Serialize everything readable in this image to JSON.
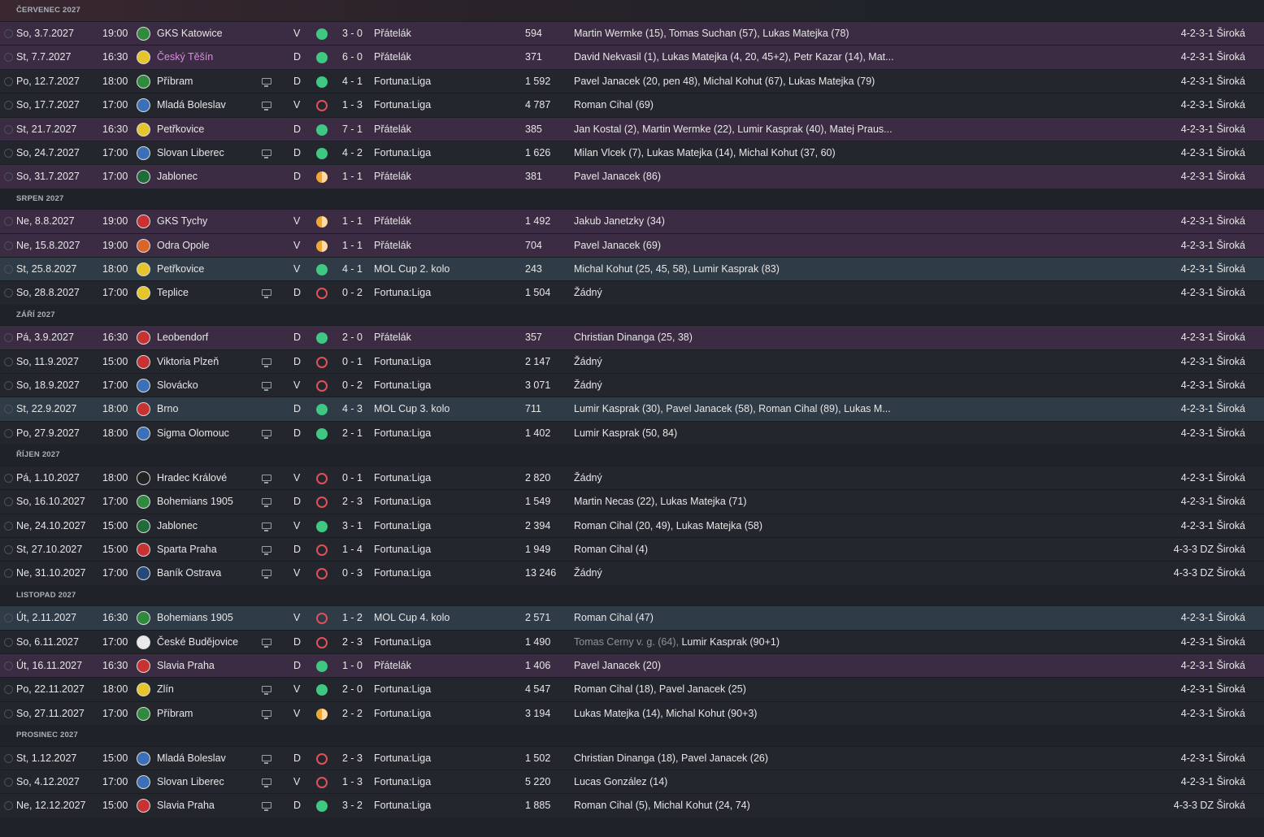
{
  "months": [
    {
      "label": "ČERVENEC 2027",
      "rows": [
        {
          "type": "friendly",
          "date": "So, 3.7.2027",
          "time": "19:00",
          "badge": "gks-katowice-crest-icon",
          "badge_color": "b-green",
          "team": "GKS Katowice",
          "tv": false,
          "venue": "V",
          "result": "w",
          "score": "3 - 0",
          "comp": "Přátelák",
          "att": "594",
          "scorers": "Martin Wermke (15), Tomas Suchan (57), Lukas Matejka (78)",
          "form": "4-2-3-1 Široká"
        },
        {
          "type": "friendly",
          "date": "St, 7.7.2027",
          "time": "16:30",
          "badge": "cesky-tesin-crest-icon",
          "badge_color": "b-yellow",
          "team": "Český Těšín",
          "team_hl": true,
          "tv": false,
          "venue": "D",
          "result": "w",
          "score": "6 - 0",
          "comp": "Přátelák",
          "att": "371",
          "scorers": "David Nekvasil (1), Lukas Matejka (4, 20, 45+2), Petr Kazar (14), Mat...",
          "form": "4-2-3-1 Široká"
        },
        {
          "type": "league",
          "date": "Po, 12.7.2027",
          "time": "18:00",
          "badge": "pribram-crest-icon",
          "badge_color": "b-green",
          "team": "Příbram",
          "tv": true,
          "venue": "D",
          "result": "w",
          "score": "4 - 1",
          "comp": "Fortuna:Liga",
          "att": "1 592",
          "scorers": "Pavel Janacek (20, pen 48), Michal Kohut (67), Lukas Matejka (79)",
          "form": "4-2-3-1 Široká"
        },
        {
          "type": "league",
          "date": "So, 17.7.2027",
          "time": "17:00",
          "badge": "mlada-boleslav-crest-icon",
          "badge_color": "b-blue",
          "team": "Mladá Boleslav",
          "tv": true,
          "venue": "V",
          "result": "l",
          "score": "1 - 3",
          "comp": "Fortuna:Liga",
          "att": "4 787",
          "scorers": "Roman Cihal (69)",
          "form": "4-2-3-1 Široká"
        },
        {
          "type": "friendly",
          "date": "St, 21.7.2027",
          "time": "16:30",
          "badge": "petrkovice-crest-icon",
          "badge_color": "b-yellow",
          "team": "Petřkovice",
          "tv": false,
          "venue": "D",
          "result": "w",
          "score": "7 - 1",
          "comp": "Přátelák",
          "att": "385",
          "scorers": "Jan Kostal (2), Martin Wermke (22), Lumir Kasprak (40), Matej Praus...",
          "form": "4-2-3-1 Široká"
        },
        {
          "type": "league",
          "date": "So, 24.7.2027",
          "time": "17:00",
          "badge": "slovan-liberec-crest-icon",
          "badge_color": "b-blue",
          "team": "Slovan Liberec",
          "tv": true,
          "venue": "D",
          "result": "w",
          "score": "4 - 2",
          "comp": "Fortuna:Liga",
          "att": "1 626",
          "scorers": "Milan Vlcek (7), Lukas Matejka (14), Michal Kohut (37, 60)",
          "form": "4-2-3-1 Široká"
        },
        {
          "type": "friendly",
          "date": "So, 31.7.2027",
          "time": "17:00",
          "badge": "jablonec-crest-icon",
          "badge_color": "b-darkgreen",
          "team": "Jablonec",
          "tv": false,
          "venue": "D",
          "result": "d",
          "score": "1 - 1",
          "comp": "Přátelák",
          "att": "381",
          "scorers": "Pavel Janacek (86)",
          "form": "4-2-3-1 Široká"
        }
      ]
    },
    {
      "label": "SRPEN 2027",
      "rows": [
        {
          "type": "friendly",
          "date": "Ne, 8.8.2027",
          "time": "19:00",
          "badge": "gks-tychy-crest-icon",
          "badge_color": "b-red",
          "team": "GKS Tychy",
          "tv": false,
          "venue": "V",
          "result": "d",
          "score": "1 - 1",
          "comp": "Přátelák",
          "att": "1 492",
          "scorers": "Jakub Janetzky (34)",
          "form": "4-2-3-1 Široká"
        },
        {
          "type": "friendly",
          "date": "Ne, 15.8.2027",
          "time": "19:00",
          "badge": "odra-opole-crest-icon",
          "badge_color": "b-orange",
          "team": "Odra Opole",
          "tv": false,
          "venue": "V",
          "result": "d",
          "score": "1 - 1",
          "comp": "Přátelák",
          "att": "704",
          "scorers": "Pavel Janacek (69)",
          "form": "4-2-3-1 Široká"
        },
        {
          "type": "cup",
          "date": "St, 25.8.2027",
          "time": "18:00",
          "badge": "petrkovice-crest-icon",
          "badge_color": "b-yellow",
          "team": "Petřkovice",
          "tv": false,
          "venue": "V",
          "result": "w",
          "score": "4 - 1",
          "comp": "MOL Cup 2. kolo",
          "att": "243",
          "scorers": "Michal Kohut (25, 45, 58), Lumir Kasprak (83)",
          "form": "4-2-3-1 Široká"
        },
        {
          "type": "league",
          "date": "So, 28.8.2027",
          "time": "17:00",
          "badge": "teplice-crest-icon",
          "badge_color": "b-yellow",
          "team": "Teplice",
          "tv": true,
          "venue": "D",
          "result": "l",
          "score": "0 - 2",
          "comp": "Fortuna:Liga",
          "att": "1 504",
          "scorers": "Žádný",
          "form": "4-2-3-1 Široká"
        }
      ]
    },
    {
      "label": "ZÁŘÍ 2027",
      "rows": [
        {
          "type": "friendly",
          "date": "Pá, 3.9.2027",
          "time": "16:30",
          "badge": "leobendorf-crest-icon",
          "badge_color": "b-red",
          "team": "Leobendorf",
          "tv": false,
          "venue": "D",
          "result": "w",
          "score": "2 - 0",
          "comp": "Přátelák",
          "att": "357",
          "scorers": "Christian Dinanga (25, 38)",
          "form": "4-2-3-1 Široká"
        },
        {
          "type": "league",
          "date": "So, 11.9.2027",
          "time": "15:00",
          "badge": "viktoria-plzen-crest-icon",
          "badge_color": "b-red",
          "team": "Viktoria Plzeň",
          "tv": true,
          "venue": "D",
          "result": "l",
          "score": "0 - 1",
          "comp": "Fortuna:Liga",
          "att": "2 147",
          "scorers": "Žádný",
          "form": "4-2-3-1 Široká"
        },
        {
          "type": "league",
          "date": "So, 18.9.2027",
          "time": "17:00",
          "badge": "slovacko-crest-icon",
          "badge_color": "b-blue",
          "team": "Slovácko",
          "tv": true,
          "venue": "V",
          "result": "l",
          "score": "0 - 2",
          "comp": "Fortuna:Liga",
          "att": "3 071",
          "scorers": "Žádný",
          "form": "4-2-3-1 Široká"
        },
        {
          "type": "cup",
          "date": "St, 22.9.2027",
          "time": "18:00",
          "badge": "brno-crest-icon",
          "badge_color": "b-red",
          "team": "Brno",
          "tv": false,
          "venue": "D",
          "result": "w",
          "score": "4 - 3",
          "comp": "MOL Cup 3. kolo",
          "att": "711",
          "scorers": "Lumir Kasprak (30), Pavel Janacek (58), Roman Cihal (89), Lukas M...",
          "form": "4-2-3-1 Široká"
        },
        {
          "type": "league",
          "date": "Po, 27.9.2027",
          "time": "18:00",
          "badge": "sigma-olomouc-crest-icon",
          "badge_color": "b-blue",
          "team": "Sigma Olomouc",
          "tv": true,
          "venue": "D",
          "result": "w",
          "score": "2 - 1",
          "comp": "Fortuna:Liga",
          "att": "1 402",
          "scorers": "Lumir Kasprak (50, 84)",
          "form": "4-2-3-1 Široká"
        }
      ]
    },
    {
      "label": "ŘÍJEN 2027",
      "rows": [
        {
          "type": "league",
          "date": "Pá, 1.10.2027",
          "time": "18:00",
          "badge": "hradec-kralove-crest-icon",
          "badge_color": "b-black",
          "team": "Hradec Králové",
          "tv": true,
          "venue": "V",
          "result": "l",
          "score": "0 - 1",
          "comp": "Fortuna:Liga",
          "att": "2 820",
          "scorers": "Žádný",
          "form": "4-2-3-1 Široká"
        },
        {
          "type": "league",
          "date": "So, 16.10.2027",
          "time": "17:00",
          "badge": "bohemians-1905-crest-icon",
          "badge_color": "b-green",
          "team": "Bohemians 1905",
          "tv": true,
          "venue": "D",
          "result": "l",
          "score": "2 - 3",
          "comp": "Fortuna:Liga",
          "att": "1 549",
          "scorers": "Martin Necas (22), Lukas Matejka (71)",
          "form": "4-2-3-1 Široká"
        },
        {
          "type": "league",
          "date": "Ne, 24.10.2027",
          "time": "15:00",
          "badge": "jablonec-crest-icon",
          "badge_color": "b-darkgreen",
          "team": "Jablonec",
          "tv": true,
          "venue": "V",
          "result": "w",
          "score": "3 - 1",
          "comp": "Fortuna:Liga",
          "att": "2 394",
          "scorers": "Roman Cihal (20, 49), Lukas Matejka (58)",
          "form": "4-2-3-1 Široká"
        },
        {
          "type": "league",
          "date": "St, 27.10.2027",
          "time": "15:00",
          "badge": "sparta-praha-crest-icon",
          "badge_color": "b-red",
          "team": "Sparta Praha",
          "tv": true,
          "venue": "D",
          "result": "l",
          "score": "1 - 4",
          "comp": "Fortuna:Liga",
          "att": "1 949",
          "scorers": "Roman Cihal (4)",
          "form": "4-3-3 DZ Široká"
        },
        {
          "type": "league",
          "date": "Ne, 31.10.2027",
          "time": "17:00",
          "badge": "banik-ostrava-crest-icon",
          "badge_color": "b-navy",
          "team": "Baník Ostrava",
          "tv": true,
          "venue": "V",
          "result": "l",
          "score": "0 - 3",
          "comp": "Fortuna:Liga",
          "att": "13 246",
          "scorers": "Žádný",
          "form": "4-3-3 DZ Široká"
        }
      ]
    },
    {
      "label": "LISTOPAD 2027",
      "rows": [
        {
          "type": "cup",
          "date": "Út, 2.11.2027",
          "time": "16:30",
          "badge": "bohemians-1905-crest-icon",
          "badge_color": "b-green",
          "team": "Bohemians 1905",
          "tv": false,
          "venue": "V",
          "result": "l",
          "score": "1 - 2",
          "comp": "MOL Cup 4. kolo",
          "att": "2 571",
          "scorers": "Roman Cihal (47)",
          "form": "4-2-3-1 Široká"
        },
        {
          "type": "league",
          "date": "So, 6.11.2027",
          "time": "17:00",
          "badge": "ceske-budejovice-crest-icon",
          "badge_color": "b-white",
          "team": "České Budějovice",
          "tv": true,
          "venue": "D",
          "result": "l",
          "score": "2 - 3",
          "comp": "Fortuna:Liga",
          "att": "1 490",
          "scorers_og": "Tomas Cerny v. g. (64),",
          "scorers": " Lumir Kasprak (90+1)",
          "form": "4-2-3-1 Široká"
        },
        {
          "type": "friendly",
          "date": "Út, 16.11.2027",
          "time": "16:30",
          "badge": "slavia-praha-crest-icon",
          "badge_color": "b-red",
          "team": "Slavia Praha",
          "tv": false,
          "venue": "D",
          "result": "w",
          "score": "1 - 0",
          "comp": "Přátelák",
          "att": "1 406",
          "scorers": "Pavel Janacek (20)",
          "form": "4-2-3-1 Široká"
        },
        {
          "type": "league",
          "date": "Po, 22.11.2027",
          "time": "18:00",
          "badge": "zlin-crest-icon",
          "badge_color": "b-yellow",
          "team": "Zlín",
          "tv": true,
          "venue": "V",
          "result": "w",
          "score": "2 - 0",
          "comp": "Fortuna:Liga",
          "att": "4 547",
          "scorers": "Roman Cihal (18), Pavel Janacek (25)",
          "form": "4-2-3-1 Široká"
        },
        {
          "type": "league",
          "date": "So, 27.11.2027",
          "time": "17:00",
          "badge": "pribram-crest-icon",
          "badge_color": "b-green",
          "team": "Příbram",
          "tv": true,
          "venue": "V",
          "result": "d",
          "score": "2 - 2",
          "comp": "Fortuna:Liga",
          "att": "3 194",
          "scorers": "Lukas Matejka (14), Michal Kohut (90+3)",
          "form": "4-2-3-1 Široká"
        }
      ]
    },
    {
      "label": "PROSINEC 2027",
      "rows": [
        {
          "type": "league",
          "date": "St, 1.12.2027",
          "time": "15:00",
          "badge": "mlada-boleslav-crest-icon",
          "badge_color": "b-blue",
          "team": "Mladá Boleslav",
          "tv": true,
          "venue": "D",
          "result": "l",
          "score": "2 - 3",
          "comp": "Fortuna:Liga",
          "att": "1 502",
          "scorers": "Christian Dinanga (18), Pavel Janacek (26)",
          "form": "4-2-3-1 Široká"
        },
        {
          "type": "league",
          "date": "So, 4.12.2027",
          "time": "17:00",
          "badge": "slovan-liberec-crest-icon",
          "badge_color": "b-blue",
          "team": "Slovan Liberec",
          "tv": true,
          "venue": "V",
          "result": "l",
          "score": "1 - 3",
          "comp": "Fortuna:Liga",
          "att": "5 220",
          "scorers": "Lucas González (14)",
          "form": "4-2-3-1 Široká"
        },
        {
          "type": "league",
          "date": "Ne, 12.12.2027",
          "time": "15:00",
          "badge": "slavia-praha-crest-icon",
          "badge_color": "b-red",
          "team": "Slavia Praha",
          "tv": true,
          "venue": "D",
          "result": "w",
          "score": "3 - 2",
          "comp": "Fortuna:Liga",
          "att": "1 885",
          "scorers": "Roman Cihal (5), Michal Kohut (24, 74)",
          "form": "4-3-3 DZ Široká"
        }
      ]
    }
  ],
  "icons": {
    "tv": "tv-icon",
    "result_win": "win-dot-icon",
    "result_loss": "loss-ring-icon",
    "result_draw": "draw-half-icon",
    "check": "row-check-icon"
  }
}
